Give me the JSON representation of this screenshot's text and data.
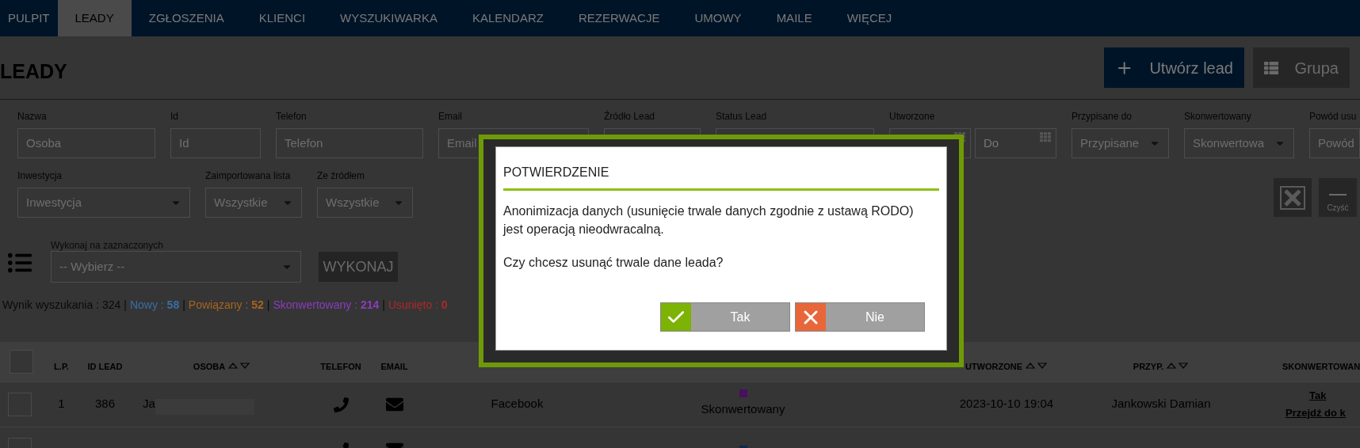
{
  "nav": [
    {
      "label": "PULPIT",
      "selected": false
    },
    {
      "label": "LEADY",
      "selected": true
    },
    {
      "label": "ZGŁOSZENIA",
      "selected": false
    },
    {
      "label": "KLIENCI",
      "selected": false
    },
    {
      "label": "WYSZUKIWARKA",
      "selected": false
    },
    {
      "label": "KALENDARZ",
      "selected": false
    },
    {
      "label": "REZERWACJE",
      "selected": false
    },
    {
      "label": "UMOWY",
      "selected": false
    },
    {
      "label": "MAILE",
      "selected": false
    },
    {
      "label": "WIĘCEJ",
      "selected": false
    }
  ],
  "page_title": "LEADY",
  "header_buttons": [
    {
      "label": "Utwórz lead",
      "kind": "create"
    },
    {
      "label": "Grupa",
      "kind": "group"
    }
  ],
  "filters_row_1": [
    {
      "label": "Nazwa",
      "kind": "text",
      "placeholder": "Osoba"
    },
    {
      "label": "Id",
      "kind": "text",
      "placeholder": "Id"
    },
    {
      "label": "Telefon",
      "kind": "text",
      "placeholder": "Telefon"
    },
    {
      "label": "Email",
      "kind": "text",
      "placeholder": "Email"
    },
    {
      "label": "Źródło Lead",
      "kind": "select_covered"
    },
    {
      "label": "Status Lead",
      "kind": "select_covered"
    },
    {
      "label": "Utworzone",
      "kind": "date_range",
      "end_placeholder": "Do"
    },
    {
      "label": "Przypisane do",
      "kind": "select",
      "placeholder": "Przypisane"
    },
    {
      "label": "Skonwertowany",
      "kind": "select",
      "placeholder": "Skonwertowa"
    },
    {
      "label": "Powód usu",
      "kind": "text",
      "placeholder": "Powód"
    }
  ],
  "filters_row_2": [
    {
      "label": "Inwestycja",
      "kind": "select",
      "placeholder": "Inwestycja"
    },
    {
      "label": "Zaimportowana lista",
      "kind": "select",
      "placeholder": "Wszystkie"
    },
    {
      "label": "Ze źródłem",
      "kind": "select",
      "placeholder": "Wszystkie"
    }
  ],
  "filter_actions": [
    {
      "kind": "export"
    },
    {
      "kind": "clear",
      "label": "Czyść"
    }
  ],
  "bulk_action": {
    "label": "Wykonaj na zaznaczonych",
    "placeholder": "-- Wybierz --",
    "button": "WYKONAJ"
  },
  "summary": {
    "separator": "|",
    "items": [
      {
        "kind": "total",
        "label": "Wynik wyszukania :",
        "value": "324",
        "color": "#0a0a0a"
      },
      {
        "kind": "status",
        "label": "Nowy :",
        "value": "58",
        "color": "#3a6ea8"
      },
      {
        "kind": "status",
        "label": "Powiązany :",
        "value": "52",
        "color": "#a8641e"
      },
      {
        "kind": "status",
        "label": "Skonwertowany :",
        "value": "214",
        "color": "#8a3cc0"
      },
      {
        "kind": "status",
        "label": "Usunięto :",
        "value": "0",
        "color": "#b02828"
      }
    ]
  },
  "table": {
    "all_selected": false,
    "columns": [
      {
        "label": "L.P.",
        "sortable": false
      },
      {
        "label": "ID LEAD",
        "sortable": false
      },
      {
        "label": "OSOBA",
        "sortable": true
      },
      {
        "label": "TELEFON",
        "sortable": false
      },
      {
        "label": "EMAIL",
        "sortable": false
      },
      {
        "label": "UTWORZONE",
        "sortable": true
      },
      {
        "label": "PRZYP.",
        "sortable": true
      },
      {
        "label": "SKONWERTOWAN"
      }
    ],
    "rows": [
      {
        "checked": false,
        "lp": "1",
        "id": "386",
        "person": "Ja",
        "source": "Facebook",
        "status": {
          "label": "Skonwertowany",
          "color": "#4a0f5e"
        },
        "created": "2023-10-10 19:04",
        "assigned": "Jankowski Damian",
        "converted": "Tak",
        "converted_link": "Przejdź do k"
      },
      {
        "checked": false,
        "status": {
          "color": "#0d2a4a"
        }
      }
    ]
  },
  "dialog": {
    "title": "POTWIERDZENIE",
    "message": "Anonimizacja danych (usunięcie trwale danych zgodnie z ustawą RODO) jest operacją nieodwracalną.",
    "question": "Czy chcesz usunąć trwale dane leada?",
    "buttons": [
      {
        "label": "Tak",
        "kind": "confirm"
      },
      {
        "label": "Nie",
        "kind": "cancel"
      }
    ]
  }
}
